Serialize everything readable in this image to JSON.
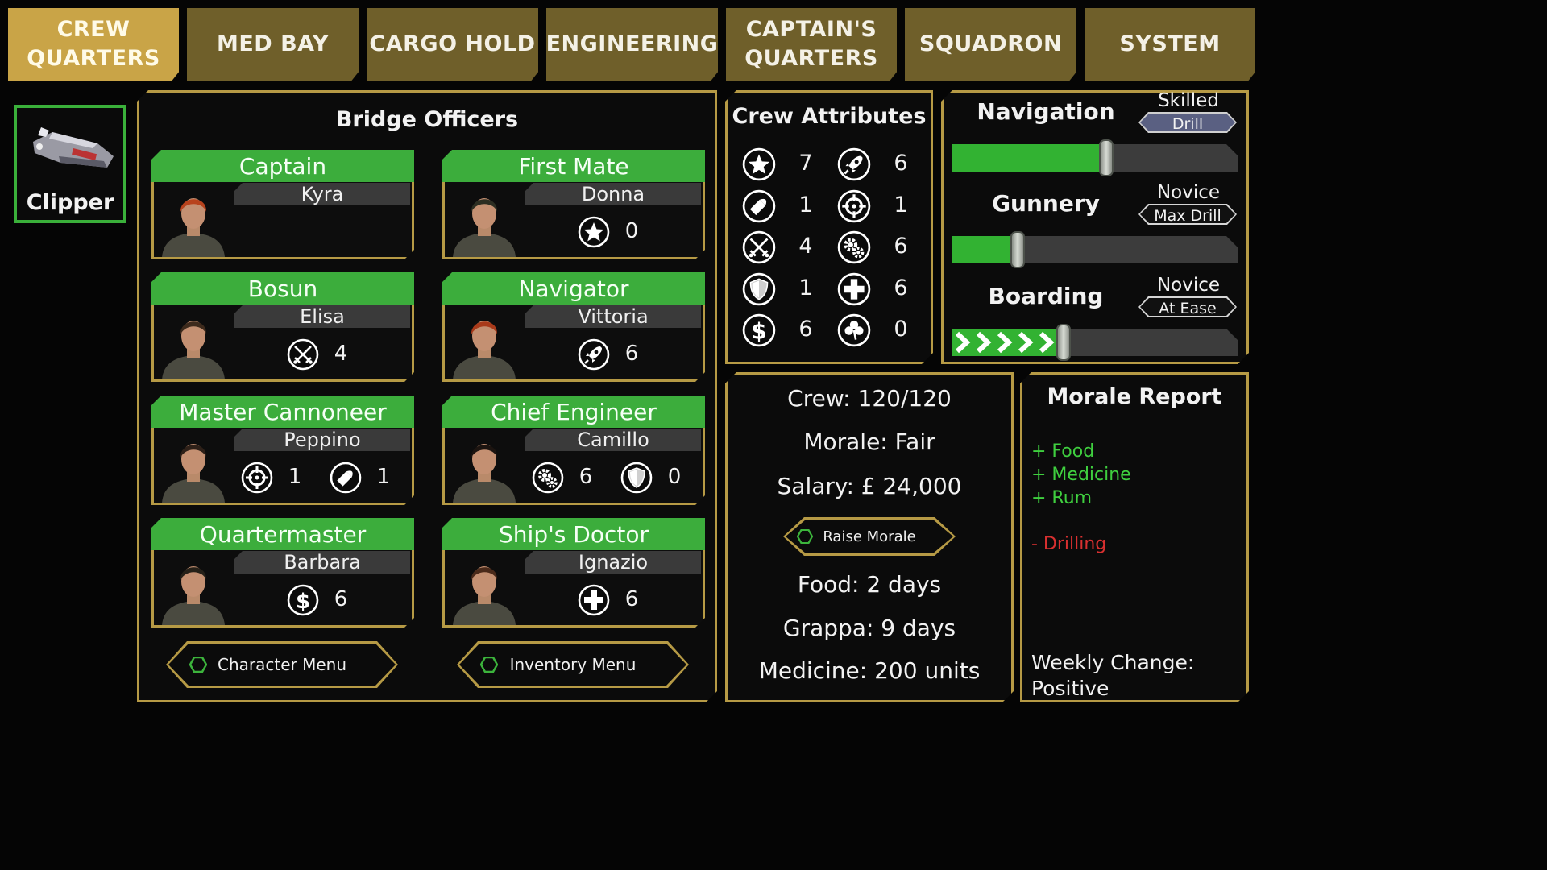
{
  "tabs": [
    {
      "label": "CREW\nQUARTERS",
      "active": true
    },
    {
      "label": "MED BAY",
      "active": false
    },
    {
      "label": "CARGO HOLD",
      "active": false
    },
    {
      "label": "ENGINEERING",
      "active": false
    },
    {
      "label": "CAPTAIN'S\nQUARTERS",
      "active": false
    },
    {
      "label": "SQUADRON",
      "active": false
    },
    {
      "label": "SYSTEM",
      "active": false
    }
  ],
  "ship": {
    "name": "Clipper"
  },
  "bridge": {
    "title": "Bridge Officers",
    "officers": [
      {
        "role": "Captain",
        "name": "Kyra",
        "stats": []
      },
      {
        "role": "First Mate",
        "name": "Donna",
        "stats": [
          {
            "icon": "star-icon",
            "value": "0"
          }
        ]
      },
      {
        "role": "Bosun",
        "name": "Elisa",
        "stats": [
          {
            "icon": "crossed-swords-icon",
            "value": "4"
          }
        ]
      },
      {
        "role": "Navigator",
        "name": "Vittoria",
        "stats": [
          {
            "icon": "rocket-icon",
            "value": "6"
          }
        ]
      },
      {
        "role": "Master Cannoneer",
        "name": "Peppino",
        "stats": [
          {
            "icon": "crosshair-icon",
            "value": "1"
          },
          {
            "icon": "bullet-icon",
            "value": "1"
          }
        ]
      },
      {
        "role": "Chief Engineer",
        "name": "Camillo",
        "stats": [
          {
            "icon": "gears-icon",
            "value": "6"
          },
          {
            "icon": "shield-icon",
            "value": "0"
          }
        ]
      },
      {
        "role": "Quartermaster",
        "name": "Barbara",
        "stats": [
          {
            "icon": "dollar-icon",
            "value": "6"
          }
        ]
      },
      {
        "role": "Ship's Doctor",
        "name": "Ignazio",
        "stats": [
          {
            "icon": "medical-cross-icon",
            "value": "6"
          }
        ]
      }
    ],
    "character_menu": "Character Menu",
    "inventory_menu": "Inventory Menu"
  },
  "attributes": {
    "title": "Crew Attributes",
    "items": [
      {
        "icon": "star-icon",
        "value": "7"
      },
      {
        "icon": "rocket-icon",
        "value": "6"
      },
      {
        "icon": "bullet-icon",
        "value": "1"
      },
      {
        "icon": "crosshair-icon",
        "value": "1"
      },
      {
        "icon": "crossed-swords-icon",
        "value": "4"
      },
      {
        "icon": "gears-icon",
        "value": "6"
      },
      {
        "icon": "shield-icon",
        "value": "1"
      },
      {
        "icon": "medical-cross-icon",
        "value": "6"
      },
      {
        "icon": "dollar-icon",
        "value": "6"
      },
      {
        "icon": "clover-icon",
        "value": "0"
      }
    ]
  },
  "skills": [
    {
      "name": "Navigation",
      "level": "Skilled",
      "action": "Drill",
      "action_active": true,
      "progress": 0.54
    },
    {
      "name": "Gunnery",
      "level": "Novice",
      "action": "Max Drill",
      "action_active": false,
      "progress": 0.23
    },
    {
      "name": "Boarding",
      "level": "Novice",
      "action": "At Ease",
      "action_active": false,
      "progress": 0.39
    }
  ],
  "crew": {
    "crew": "Crew: 120/120",
    "morale": "Morale: Fair",
    "salary": "Salary: £ 24,000",
    "raise_morale": "Raise Morale",
    "food": "Food: 2 days",
    "grappa": "Grappa: 9 days",
    "medicine": "Medicine: 200 units"
  },
  "morale_report": {
    "title": "Morale Report",
    "positives": [
      "+ Food",
      "+ Medicine",
      "+ Rum"
    ],
    "negatives": [
      "- Drilling"
    ],
    "weekly_label": "Weekly Change:",
    "weekly_value": "Positive"
  },
  "colors": {
    "tab": "#6f5f2a",
    "tab_active": "#c9a447",
    "panel_border": "#b69a45",
    "green": "#3cad3c",
    "positive": "#3fcf3f",
    "negative": "#d93030",
    "pill_active": "#5a6082"
  }
}
